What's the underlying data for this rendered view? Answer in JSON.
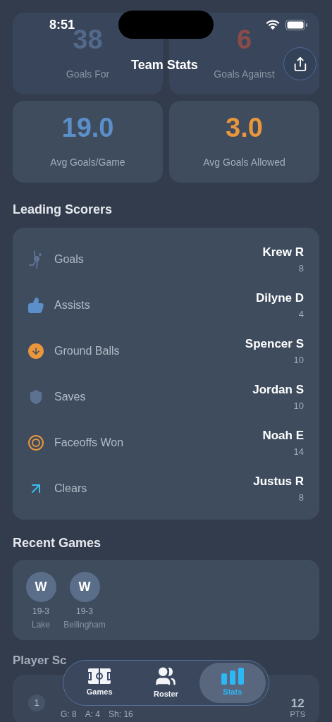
{
  "status_bar": {
    "time": "8:51"
  },
  "header": {
    "title": "Team Stats"
  },
  "summary_cards": [
    {
      "value": "38",
      "label": "Goals For",
      "color": "#52698a",
      "faded": true
    },
    {
      "value": "6",
      "label": "Goals Against",
      "color": "#8a4c4a",
      "faded": true
    },
    {
      "value": "19.0",
      "label": "Avg Goals/Game",
      "color": "#5b8fc9",
      "faded": false
    },
    {
      "value": "3.0",
      "label": "Avg Goals Allowed",
      "color": "#e9963d",
      "faded": false
    }
  ],
  "leading_scorers": {
    "title": "Leading Scorers",
    "rows": [
      {
        "kind": "goals",
        "category": "Goals",
        "player": "Krew R",
        "count": "8"
      },
      {
        "kind": "assists",
        "category": "Assists",
        "player": "Dilyne D",
        "count": "4"
      },
      {
        "kind": "ground_balls",
        "category": "Ground Balls",
        "player": "Spencer S",
        "count": "10"
      },
      {
        "kind": "saves",
        "category": "Saves",
        "player": "Jordan S",
        "count": "10"
      },
      {
        "kind": "faceoffs",
        "category": "Faceoffs Won",
        "player": "Noah E",
        "count": "14"
      },
      {
        "kind": "clears",
        "category": "Clears",
        "player": "Justus R",
        "count": "8"
      }
    ]
  },
  "recent_games": {
    "title": "Recent Games",
    "games": [
      {
        "result": "W",
        "score": "19-3",
        "opponent": "Lake"
      },
      {
        "result": "W",
        "score": "19-3",
        "opponent": "Bellingham"
      }
    ]
  },
  "player_scoring": {
    "title": "Player Sc",
    "rows": [
      {
        "rank": "1",
        "stats": [
          "G: 8",
          "A: 4",
          "Sh: 16"
        ],
        "points": "12",
        "points_label": "PTS"
      }
    ]
  },
  "tab_bar": [
    {
      "kind": "games",
      "label": "Games",
      "selected": false
    },
    {
      "kind": "roster",
      "label": "Roster",
      "selected": false
    },
    {
      "kind": "stats",
      "label": "Stats",
      "selected": true
    }
  ]
}
